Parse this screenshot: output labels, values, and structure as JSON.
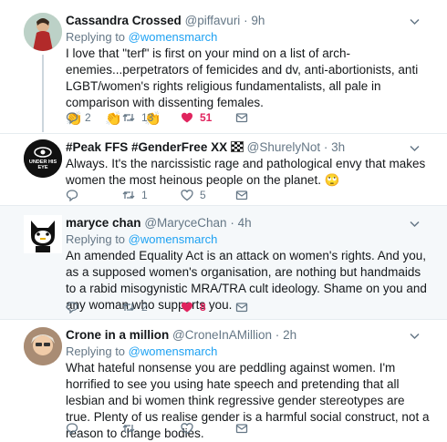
{
  "tweets": [
    {
      "name": "Cassandra Crossed",
      "handle": "@piffavuri",
      "dot": "·",
      "time": "9h",
      "replying_prefix": "Replying to",
      "replying_to": "@womensmarch",
      "text": "I love that \"terf\" is first on your mind on a list of arch-enemies...perpetrators of femicides and dv, anti-abortionists, anti LGBT/women's rights religious fundamentalists, all pale in comparison with dissenting females.",
      "emoji": [
        "👏",
        "👏",
        "👏"
      ],
      "replies": "2",
      "retweets": "13",
      "likes": "51"
    },
    {
      "name": "#Peak FFS #GenderFree XX",
      "handle": "@ShurelyNot",
      "dot": "·",
      "time": "3h",
      "avatar_text": "UNDER HIS EYE",
      "text": "Always. It's the narcissistic rage and pathological envy that makes women the most heinous people on the planet. 🙄",
      "replies": "",
      "retweets": "1",
      "likes": "5"
    },
    {
      "name": "maryce chan",
      "handle": "@MaryceChan",
      "dot": "·",
      "time": "4h",
      "replying_prefix": "Replying to",
      "replying_to": "@womensmarch",
      "text": "An amended Equality Act is an attack on women's rights. And you, as a supposed women's organisation, are nothing but handmaids to a rabid misogynistic MRA/TRA cult ideology. Shame on you and any woman who supports you.",
      "replies": "",
      "retweets": "2",
      "likes": "8"
    },
    {
      "name": "Crone in a million",
      "handle": "@CroneInAMillion",
      "dot": "·",
      "time": "2h",
      "replying_prefix": "Replying to",
      "replying_to": "@womensmarch",
      "text": "What hateful nonsense you are peddling against women.  I'm horrified to see you using hate speech and pretending that all lesbian and bi women think regressive gender stereotypes are true.  Plenty of us realise gender is a harmful social construct, not a reason to change bodies."
    }
  ],
  "colors": {
    "link": "#1da1f2",
    "like": "#e0245e",
    "muted": "#657786",
    "border": "#e6ecf0"
  }
}
